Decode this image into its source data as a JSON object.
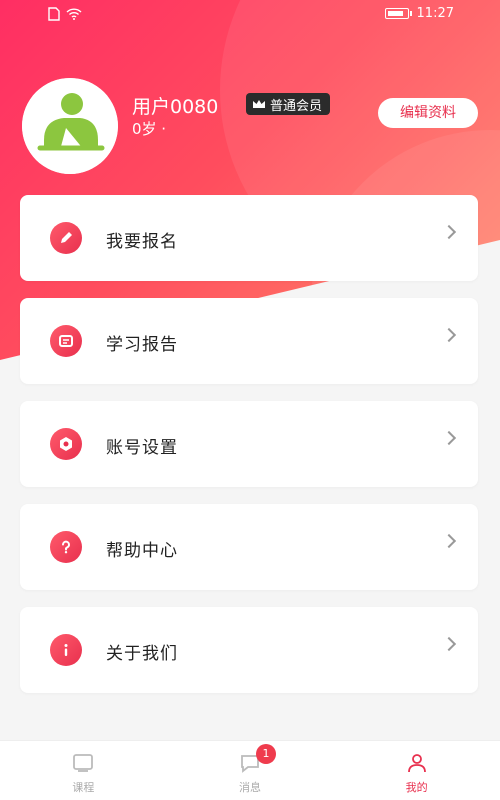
{
  "status_bar": {
    "time": "11:27"
  },
  "profile": {
    "username": "用户0080",
    "vip_label": "普通会员",
    "age_text": "0岁 ·",
    "edit_label": "编辑资料"
  },
  "menu": {
    "items": [
      {
        "label": "我要报名",
        "icon": "edit-icon"
      },
      {
        "label": "学习报告",
        "icon": "report-icon"
      },
      {
        "label": "账号设置",
        "icon": "settings-icon"
      },
      {
        "label": "帮助中心",
        "icon": "help-icon"
      },
      {
        "label": "关于我们",
        "icon": "info-icon"
      }
    ]
  },
  "tabbar": {
    "items": [
      {
        "label": "课程",
        "icon": "course-icon"
      },
      {
        "label": "消息",
        "icon": "message-icon",
        "badge": "1"
      },
      {
        "label": "我的",
        "icon": "profile-icon"
      }
    ]
  },
  "colors": {
    "accent": "#e8304e",
    "gradient_start": "#ff2e63",
    "gradient_end": "#ff8a6a"
  }
}
